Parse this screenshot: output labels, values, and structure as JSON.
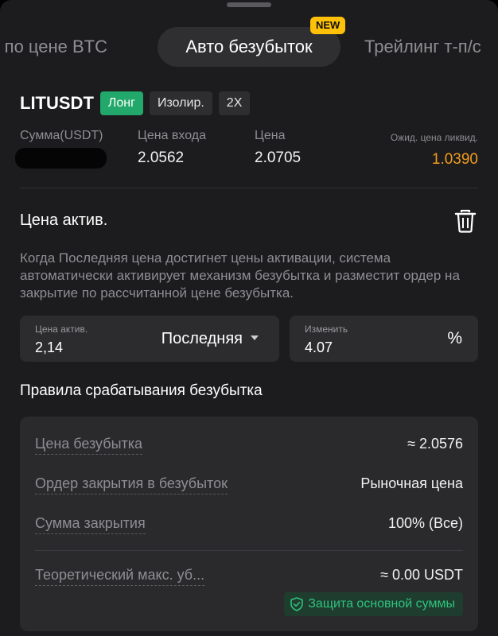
{
  "tabs": {
    "items": [
      {
        "label": "ть по цене BTC"
      },
      {
        "label": "Авто безубыток"
      },
      {
        "label": "Трейлинг т-п/с"
      }
    ],
    "new_badge": "NEW"
  },
  "position": {
    "symbol": "LITUSDT",
    "side": "Лонг",
    "margin_mode": "Изолир.",
    "leverage": "2X",
    "sum_label": "Сумма(USDT)",
    "entry_label": "Цена входа",
    "entry_value": "2.0562",
    "price_label": "Цена",
    "price_value": "2.0705",
    "liq_label": "Ожид. цена ликвид.",
    "liq_value": "1.0390",
    "liq_color": "#f39c1f"
  },
  "activation": {
    "title": "Цена актив.",
    "description": "Когда Последняя цена достигнет цены активации, система автоматически активирует механизм безубытка и разместит ордер на закрытие по рассчитанной цене безубытка.",
    "price_field_label": "Цена актив.",
    "price_field_value": "2,14",
    "price_type": "Последняя",
    "change_label": "Изменить",
    "change_value": "4.07",
    "change_unit": "%"
  },
  "rules": {
    "title": "Правила срабатывания безубытка",
    "items": [
      {
        "label": "Цена безубытка",
        "value": "≈ 2.0576"
      },
      {
        "label": "Ордер закрытия в безубыток",
        "value": "Рыночная цена"
      },
      {
        "label": "Сумма закрытия",
        "value": "100% (Все)"
      },
      {
        "label": "Теоретический макс. уб...",
        "value": "≈ 0.00 USDT"
      }
    ],
    "protection_badge": "Защита основной суммы"
  },
  "colors": {
    "long_chip": "#22a86a",
    "accent_green": "#2ec27e",
    "new_badge": "#ffc107"
  }
}
